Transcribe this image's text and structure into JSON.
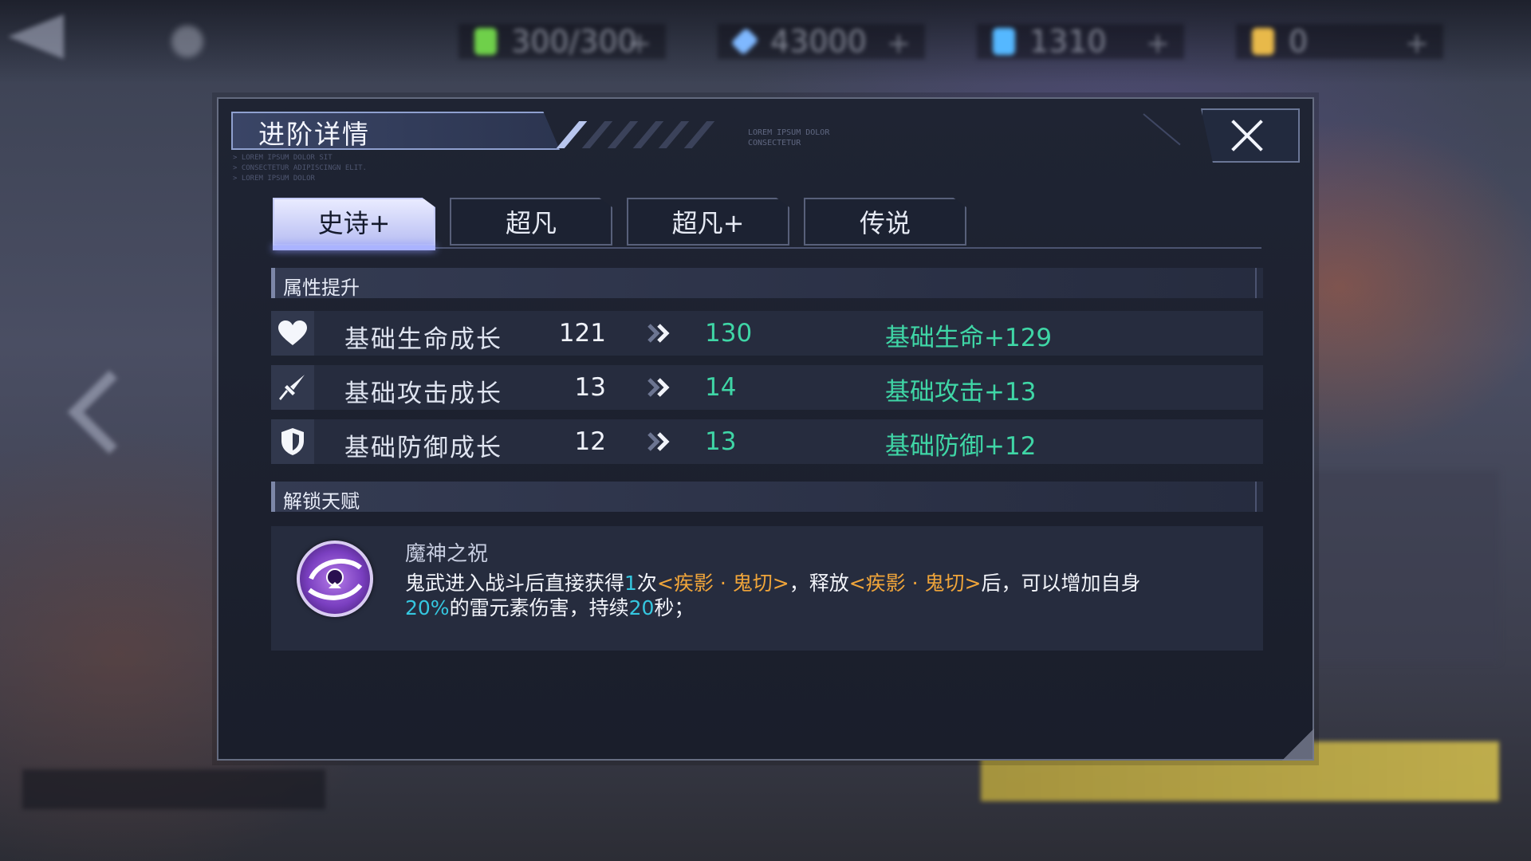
{
  "hud": {
    "resources": [
      {
        "icon": "stamina-icon",
        "value": "300/300",
        "color": "#6fd04a"
      },
      {
        "icon": "diamond-icon",
        "value": "43000",
        "color": "#7fb8ff"
      },
      {
        "icon": "ticket-icon",
        "value": "1310",
        "color": "#55b8ff"
      },
      {
        "icon": "coin-icon",
        "value": "0",
        "color": "#e8b94a"
      }
    ]
  },
  "dialog": {
    "title": "进阶详情",
    "tabs": [
      {
        "label": "史诗+",
        "active": true
      },
      {
        "label": "超凡",
        "active": false
      },
      {
        "label": "超凡+",
        "active": false
      },
      {
        "label": "传说",
        "active": false
      }
    ],
    "attributes": {
      "header": "属性提升",
      "rows": [
        {
          "icon": "heart-icon",
          "name": "基础生命成长",
          "from": "121",
          "to": "130",
          "bonus": "基础生命+129"
        },
        {
          "icon": "sword-icon",
          "name": "基础攻击成长",
          "from": "13",
          "to": "14",
          "bonus": "基础攻击+13"
        },
        {
          "icon": "shield-icon",
          "name": "基础防御成长",
          "from": "12",
          "to": "13",
          "bonus": "基础防御+12"
        }
      ]
    },
    "talent": {
      "header": "解锁天赋",
      "name": "魔神之祝",
      "desc": {
        "p1": "鬼武进入战斗后直接获得",
        "n1": "1",
        "p2": "次",
        "skill1": "<疾影 · 鬼切>",
        "p3": "，释放",
        "skill2": "<疾影 · 鬼切>",
        "p4": "后，可以增加自身",
        "n2": "20%",
        "p5": "的雷元素伤害，持续",
        "n3": "20",
        "p6": "秒；"
      }
    }
  },
  "colors": {
    "accent_green": "#3fd6a6",
    "accent_cyan": "#35c7e0",
    "accent_orange": "#f0a53a",
    "tab_active": "#c4caf6"
  }
}
